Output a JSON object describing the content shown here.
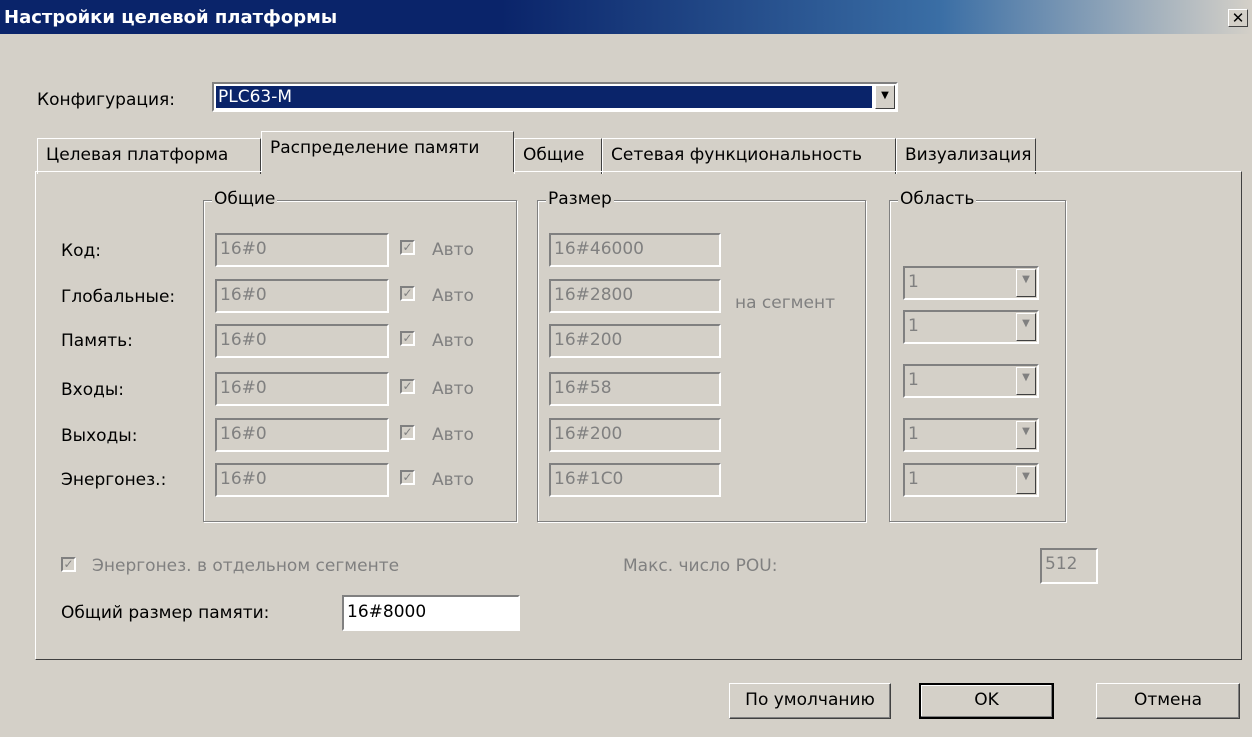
{
  "window": {
    "title": "Настройки целевой платформы",
    "close_glyph": "✕"
  },
  "config": {
    "label": "Конфигурация:",
    "value": "PLC63-M"
  },
  "tabs": [
    {
      "label": "Целевая платформа"
    },
    {
      "label": "Распределение памяти",
      "active": true
    },
    {
      "label": "Общие"
    },
    {
      "label": "Сетевая функциональность"
    },
    {
      "label": "Визуализация"
    }
  ],
  "groups": {
    "general": "Общие",
    "size": "Размер",
    "area": "Область"
  },
  "rows": [
    {
      "label": "Код:",
      "general": "16#0",
      "auto": "Авто",
      "size": "16#46000",
      "area": ""
    },
    {
      "label": "Глобальные:",
      "general": "16#0",
      "auto": "Авто",
      "size": "16#2800",
      "area": "1"
    },
    {
      "label": "Память:",
      "general": "16#0",
      "auto": "Авто",
      "size": "16#200",
      "area": "1"
    },
    {
      "label": "Входы:",
      "general": "16#0",
      "auto": "Авто",
      "size": "16#58",
      "area": "1"
    },
    {
      "label": "Выходы:",
      "general": "16#0",
      "auto": "Авто",
      "size": "16#200",
      "area": "1"
    },
    {
      "label": "Энергонез.:",
      "general": "16#0",
      "auto": "Авто",
      "size": "16#1C0",
      "area": "1"
    }
  ],
  "per_segment": "на сегмент",
  "retain_separate": {
    "label": "Энергонез. в отдельном сегменте",
    "checked": true
  },
  "max_pou": {
    "label": "Макс. число POU:",
    "value": "512"
  },
  "total_memory": {
    "label": "Общий размер памяти:",
    "value": "16#8000"
  },
  "buttons": {
    "default": "По умолчанию",
    "ok": "OK",
    "cancel": "Отмена"
  },
  "check_glyph": "✓",
  "dropdown_glyph": "▼"
}
